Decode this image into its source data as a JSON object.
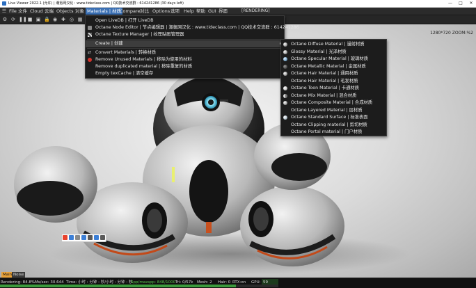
{
  "window": {
    "title": "Live Viewer 2022.1 (允许) | 潮氪网汉化 : www.tideclass.com | QQ技术交流群 : 614241286 (30 days left)"
  },
  "menubar": {
    "items": [
      "File",
      "文件",
      "Cloud",
      "云端",
      "Objects",
      "对象",
      "Materials | 材质",
      "Compare",
      "对比",
      "Options",
      "选项",
      "Help",
      "帮助",
      "GUI",
      "界面"
    ],
    "rendering": "[RENDERING]"
  },
  "viewport": {
    "resolution": "1280*720 ZOOM:%2"
  },
  "materials_menu": {
    "items": [
      {
        "label": "Open LiveDB | 打开 LiveDB",
        "icon": "none"
      },
      {
        "label": "Octane Node Editor | 节点编辑器 | 潮氪网汉化 : www.tideclass.com | QQ技术交流群 : 614241286",
        "icon": "node-editor-icon"
      },
      {
        "label": "Octane Texture Manager | 纹理贴图管理器",
        "icon": "texture-manager-icon"
      },
      {
        "label": "Create | 创建",
        "icon": "none"
      },
      {
        "label": "Convert Materials | 转换材质",
        "icon": "convert-icon"
      },
      {
        "label": "Remove Unused Materials | 移除为使用的材料",
        "icon": "remove-icon"
      },
      {
        "label": "Remove duplicated material | 移除重复的材质",
        "icon": "none"
      },
      {
        "label": "Empty texCache | 清空缓存",
        "icon": "none"
      }
    ]
  },
  "create_submenu": {
    "items": [
      {
        "label": "Octane Diffuse Material | 漫射材质",
        "icon": "ball"
      },
      {
        "label": "Glossy Material | 光泽材质",
        "icon": "ball"
      },
      {
        "label": "Octane Specular Material | 玻璃材质",
        "icon": "ball blue"
      },
      {
        "label": "Octane Metallic Material | 金属材质",
        "icon": "ball dark"
      },
      {
        "label": "Octane Hair Material | 通用材质",
        "icon": "ball"
      },
      {
        "label": "Octane Hair Material | 毛发材质",
        "icon": "none"
      },
      {
        "label": "Octane Toon Material | 卡通材质",
        "icon": "ball toon"
      },
      {
        "label": "Octane Mix Material | 混合材质",
        "icon": "ball mix"
      },
      {
        "label": "Octane Composite Material | 合成材质",
        "icon": "ball"
      },
      {
        "label": "Octane Layered Material | 层材质",
        "icon": "none"
      },
      {
        "label": "Octane Standard Surface | 标准表面",
        "icon": "ball std"
      },
      {
        "label": "Octane Clipping material | 剪切材质",
        "icon": "none"
      },
      {
        "label": "Octane Portal material | 门户材质",
        "icon": "none"
      }
    ]
  },
  "render_tabs": [
    "Main",
    "Noise"
  ],
  "status": {
    "rendering": "Rendering: 84.8%",
    "mssec": "Ms/sec: 30.644",
    "time": "Time: 小时 : 分钟 : 秒/小时 : 分钟 : 秒",
    "spp": "Spp/maxspp: 848/1000",
    "tri": "Tri: 0/57k",
    "mesh": "Mesh: 2",
    "hair": "Hair: 0",
    "rtx": "RTX:on",
    "gpu": "GPU:",
    "gpu_val": "59",
    "progress": 0.848
  },
  "colors": {
    "accent": "#3a6fb3",
    "progress": "#3c9a3c",
    "status_highlight": "#58c84c"
  }
}
